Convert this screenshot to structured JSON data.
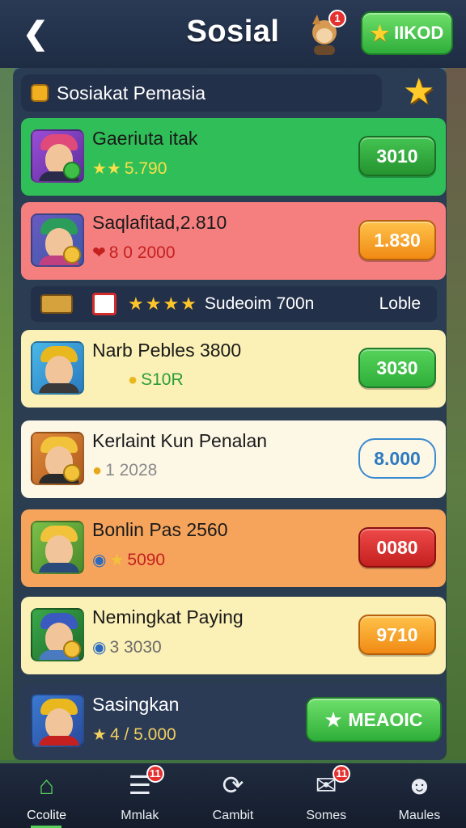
{
  "header": {
    "back_icon": "back-arrow-icon",
    "title": "Sosial",
    "avatar_badge": "1",
    "coin_label": "IIKOD"
  },
  "section": {
    "label": "Sosiakat Pemasia"
  },
  "rows": [
    {
      "name": "Gaeriuta itak",
      "sub_icon": "star-icon",
      "sub_value": "5.790",
      "button": "3010",
      "bg": "#2fbe57",
      "btn_color": "#2c9c3a"
    },
    {
      "name": "Saqlafitad,2.810",
      "sub_icon": "pin-icon",
      "sub_value": "8  0 2000",
      "button": "1.830",
      "bg": "#f57f7f",
      "btn_color": "#f0a21d"
    },
    {
      "name": "Narb Pebles 3800",
      "sub_icon": "coin-icon",
      "sub_value": "S10R",
      "button": "3030",
      "bg": "#fbf0b5",
      "btn_color": "#3fbf47"
    },
    {
      "name": "Kerlaint Kun Penalan",
      "sub_icon": "coin-icon",
      "sub_value": "1  2028",
      "button": "8.000",
      "bg": "#fdf7e6",
      "btn_color": "none"
    },
    {
      "name": "Bonlin Pas 2560",
      "sub_icon": "star-icon",
      "sub_value": "5090",
      "button": "0080",
      "bg": "#f6a45c",
      "btn_color": "#d62e2e"
    },
    {
      "name": "Nemingkat Paying",
      "sub_icon": "shield-icon",
      "sub_value": "3  3030",
      "button": "9710",
      "bg": "#fbf0b5",
      "btn_color": "#f5a020"
    }
  ],
  "divider": {
    "text": "Sudeoim 700n",
    "link": "Loble"
  },
  "last_row": {
    "name": "Sasingkan",
    "sub_value": "4 / 5.000",
    "button": "MEAOIC"
  },
  "nav": [
    {
      "label": "Ccolite",
      "icon": "home-icon",
      "badge": ""
    },
    {
      "label": "Mmlak",
      "icon": "list-icon",
      "badge": "11"
    },
    {
      "label": "Cambit",
      "icon": "refresh-icon",
      "badge": ""
    },
    {
      "label": "Somes",
      "icon": "inbox-icon",
      "badge": "11"
    },
    {
      "label": "Maules",
      "icon": "profile-icon",
      "badge": ""
    }
  ],
  "colors": {
    "accent_green": "#3fbf47",
    "header_bg": "#1e2c44",
    "panel_bg": "#28374f"
  }
}
